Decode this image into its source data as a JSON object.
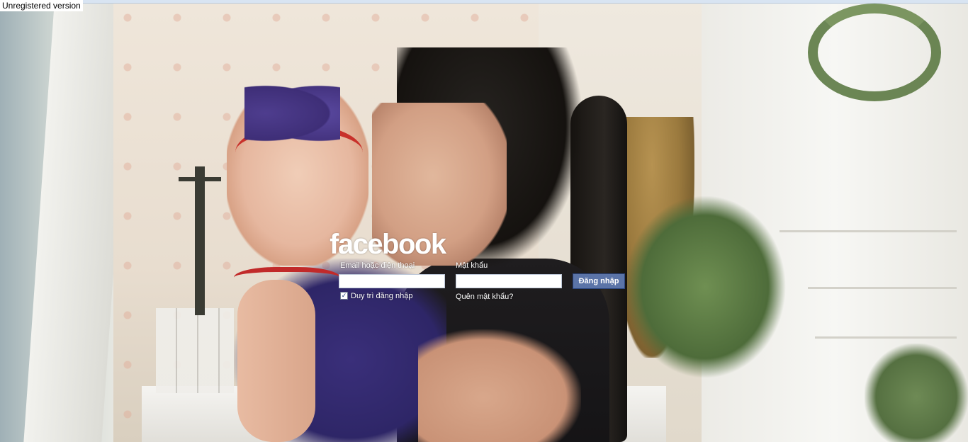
{
  "banner": {
    "text": "Unregistered version"
  },
  "login": {
    "logo": "facebook",
    "email_label": "Email hoặc điện thoại",
    "email_value": "",
    "password_label": "Mật khẩu",
    "password_value": "",
    "login_button": "Đăng nhập",
    "keep_logged_in_label": "Duy trì đăng nhập",
    "keep_logged_in_checked": true,
    "forgot_password": "Quên mật khẩu?"
  },
  "colors": {
    "button_bg": "#5b74a8",
    "button_border": "#29447e",
    "text": "#ffffff"
  }
}
